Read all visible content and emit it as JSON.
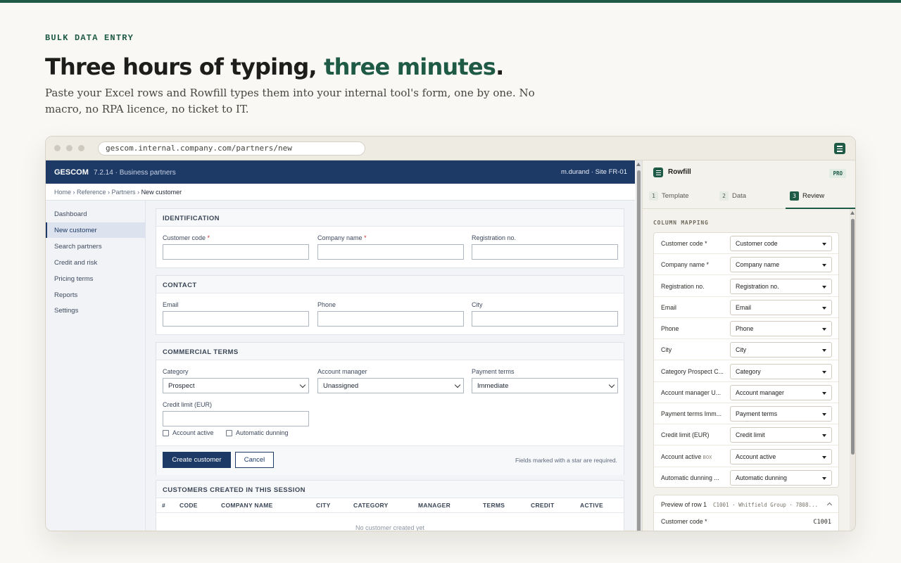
{
  "hero": {
    "eyebrow": "BULK DATA ENTRY",
    "headline_main": "Three hours of typing, ",
    "headline_accent": "three minutes",
    "headline_end": ".",
    "subtitle": "Paste your Excel rows and Rowfill types them into your internal tool's form, one by one. No macro, no RPA licence, no ticket to IT."
  },
  "browser": {
    "url": "gescom.internal.company.com/partners/new"
  },
  "app": {
    "brand": "GESCOM",
    "version": "7.2.14 · Business partners",
    "user": "m.durand · Site FR-01",
    "breadcrumb": {
      "home": "Home",
      "reference": "Reference",
      "partners": "Partners",
      "current": "New customer",
      "sep": " › "
    },
    "sidebar": [
      "Dashboard",
      "New customer",
      "Search partners",
      "Credit and risk",
      "Pricing terms",
      "Reports",
      "Settings"
    ],
    "identification": {
      "title": "IDENTIFICATION",
      "customer_code": "Customer code",
      "company_name": "Company name",
      "registration": "Registration no.",
      "required_mark": "*"
    },
    "contact": {
      "title": "CONTACT",
      "email": "Email",
      "phone": "Phone",
      "city": "City"
    },
    "commercial": {
      "title": "COMMERCIAL TERMS",
      "category_label": "Category",
      "category_value": "Prospect",
      "manager_label": "Account manager",
      "manager_value": "Unassigned",
      "terms_label": "Payment terms",
      "terms_value": "Immediate",
      "credit_label": "Credit limit (EUR)",
      "active_label": "Account active",
      "dunning_label": "Automatic dunning"
    },
    "actions": {
      "create": "Create customer",
      "cancel": "Cancel",
      "note": "Fields marked with a star are required."
    },
    "session": {
      "title": "CUSTOMERS CREATED IN THIS SESSION",
      "columns": [
        "#",
        "CODE",
        "COMPANY NAME",
        "CITY",
        "CATEGORY",
        "MANAGER",
        "TERMS",
        "CREDIT",
        "ACTIVE"
      ],
      "empty": "No customer created yet"
    }
  },
  "panel": {
    "name": "Rowfill",
    "badge": "PRO",
    "tabs": [
      {
        "num": "1",
        "label": "Template"
      },
      {
        "num": "2",
        "label": "Data"
      },
      {
        "num": "3",
        "label": "Review"
      }
    ],
    "section": "COLUMN MAPPING",
    "mapping": [
      {
        "field": "Customer code *",
        "hint": "",
        "column": "Customer code"
      },
      {
        "field": "Company name *",
        "hint": "",
        "column": "Company name"
      },
      {
        "field": "Registration no.",
        "hint": "",
        "column": "Registration no."
      },
      {
        "field": "Email",
        "hint": "",
        "column": "Email"
      },
      {
        "field": "Phone",
        "hint": "",
        "column": "Phone"
      },
      {
        "field": "City",
        "hint": "",
        "column": "City"
      },
      {
        "field": "Category Prospect C...",
        "hint": "",
        "column": "Category"
      },
      {
        "field": "Account manager U...",
        "hint": "",
        "column": "Account manager"
      },
      {
        "field": "Payment terms Imm...",
        "hint": "",
        "column": "Payment terms"
      },
      {
        "field": "Credit limit (EUR)",
        "hint": "",
        "column": "Credit limit"
      },
      {
        "field": "Account active ",
        "hint": "BOX",
        "column": "Account active"
      },
      {
        "field": "Automatic dunning ...",
        "hint": "",
        "column": "Automatic dunning"
      }
    ],
    "preview": {
      "title": "Preview of row 1",
      "summary": "C1001 · Whitfield Group · 7808...",
      "field": "Customer code *",
      "value": "C1001"
    }
  }
}
